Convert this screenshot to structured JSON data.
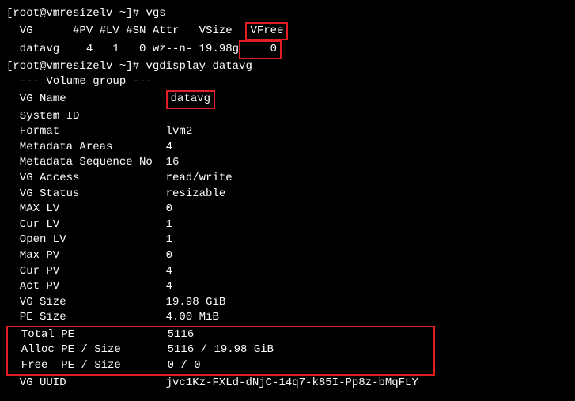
{
  "prompts": {
    "p1": "[root@vmresizelv ~]# ",
    "p2": "[root@vmresizelv ~]# "
  },
  "commands": {
    "cmd1": "vgs",
    "cmd2": "vgdisplay datavg"
  },
  "vgs": {
    "header_pre": "  VG      #PV #LV #SN Attr   VSize  ",
    "header_vfree": "VFree",
    "row_pre": "  datavg    4   1   0 wz--n- 19.98g",
    "row_vfree": "    0"
  },
  "vgd": {
    "section": "  --- Volume group ---",
    "vgname_lbl": "  VG Name               ",
    "vgname_val": "datavg",
    "systemid": "  System ID",
    "format": "  Format                lvm2",
    "metaareas": "  Metadata Areas        4",
    "metaseq": "  Metadata Sequence No  16",
    "vgaccess": "  VG Access             read/write",
    "vgstatus": "  VG Status             resizable",
    "maxlv": "  MAX LV                0",
    "curlv": "  Cur LV                1",
    "openlv": "  Open LV               1",
    "maxpv": "  Max PV                0",
    "curpv": "  Cur PV                4",
    "actpv": "  Act PV                4",
    "vgsize": "  VG Size               19.98 GiB",
    "pesize": "  PE Size               4.00 MiB",
    "totalpe": "  Total PE              5116",
    "allocpe": "  Alloc PE / Size       5116 / 19.98 GiB",
    "freepe": "  Free  PE / Size       0 / 0",
    "vguuid": "  VG UUID               jvc1Kz-FXLd-dNjC-14q7-k85I-Pp8z-bMqFLY"
  },
  "chart_data": {
    "type": "table",
    "title": "LVM Volume Group Output",
    "vgs_table": {
      "columns": [
        "VG",
        "#PV",
        "#LV",
        "#SN",
        "Attr",
        "VSize",
        "VFree"
      ],
      "rows": [
        [
          "datavg",
          4,
          1,
          0,
          "wz--n-",
          "19.98g",
          0
        ]
      ]
    },
    "vgdisplay_table": {
      "fields": {
        "VG Name": "datavg",
        "System ID": "",
        "Format": "lvm2",
        "Metadata Areas": 4,
        "Metadata Sequence No": 16,
        "VG Access": "read/write",
        "VG Status": "resizable",
        "MAX LV": 0,
        "Cur LV": 1,
        "Open LV": 1,
        "Max PV": 0,
        "Cur PV": 4,
        "Act PV": 4,
        "VG Size": "19.98 GiB",
        "PE Size": "4.00 MiB",
        "Total PE": 5116,
        "Alloc PE / Size": "5116 / 19.98 GiB",
        "Free PE / Size": "0 / 0",
        "VG UUID": "jvc1Kz-FXLd-dNjC-14q7-k85I-Pp8z-bMqFLY"
      }
    },
    "highlighted": [
      "VFree",
      "0",
      "datavg",
      "Total PE",
      "Alloc PE / Size",
      "Free PE / Size"
    ]
  }
}
